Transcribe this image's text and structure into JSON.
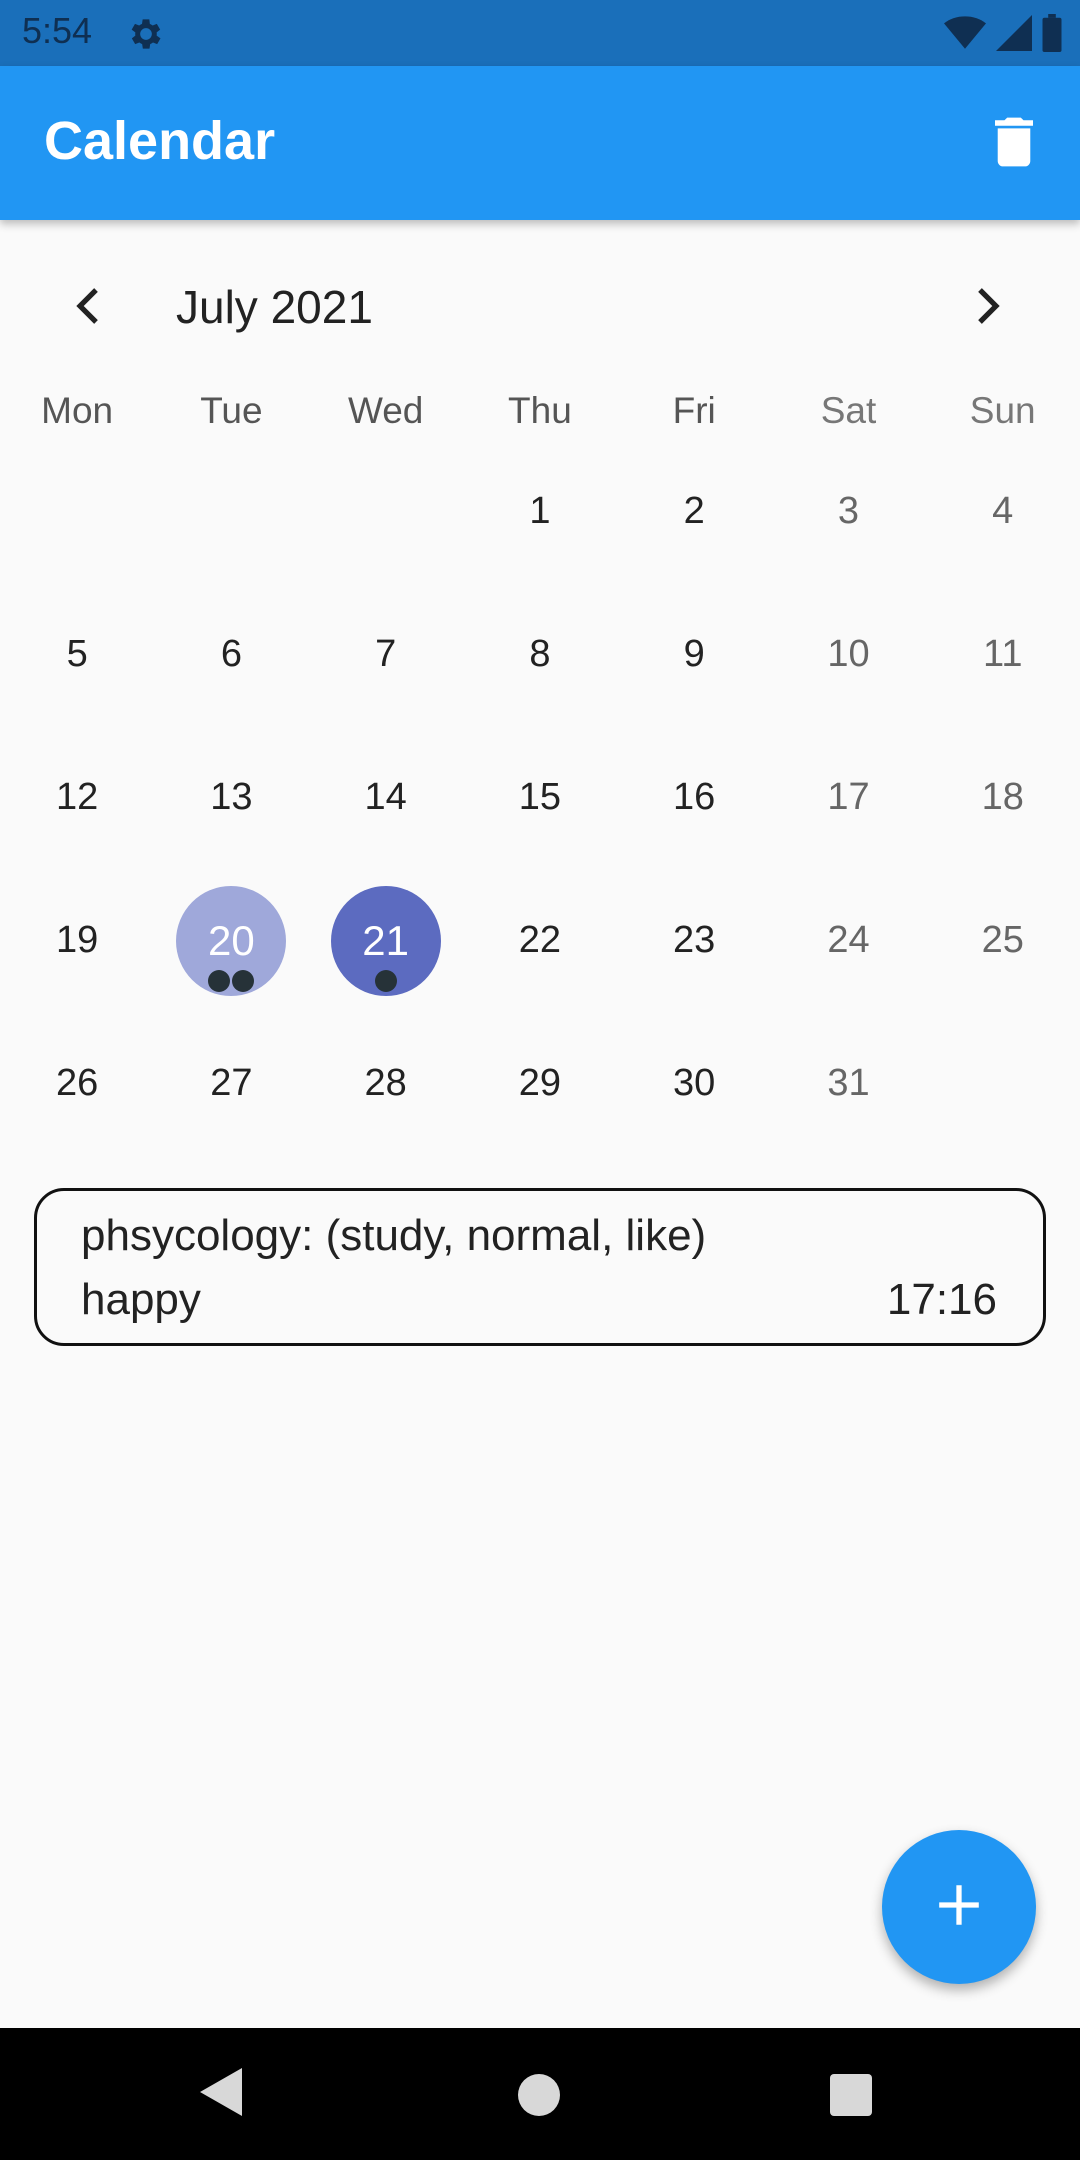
{
  "status_bar": {
    "time": "5:54",
    "icons": [
      "gear-icon",
      "wifi-icon",
      "signal-icon",
      "battery-icon"
    ]
  },
  "app_bar": {
    "title": "Calendar",
    "action_icon": "trash-icon"
  },
  "calendar": {
    "month_label": "July 2021",
    "weekdays": [
      "Mon",
      "Tue",
      "Wed",
      "Thu",
      "Fri",
      "Sat",
      "Sun"
    ],
    "weeks": [
      [
        "",
        "",
        "",
        "1",
        "2",
        "3",
        "4"
      ],
      [
        "5",
        "6",
        "7",
        "8",
        "9",
        "10",
        "11"
      ],
      [
        "12",
        "13",
        "14",
        "15",
        "16",
        "17",
        "18"
      ],
      [
        "19",
        "20",
        "21",
        "22",
        "23",
        "24",
        "25"
      ],
      [
        "26",
        "27",
        "28",
        "29",
        "30",
        "31",
        ""
      ]
    ],
    "highlighted_day": "20",
    "selected_day": "21",
    "event_markers": {
      "20": 2,
      "21": 1
    }
  },
  "event": {
    "title": "phsycology: (study, normal, like)",
    "mood": "happy",
    "time": "17:16"
  },
  "fab": {
    "icon": "plus-icon"
  },
  "colors": {
    "status_bar": "#1a6fba",
    "primary": "#2196f3",
    "highlight_light": "#9fa8da",
    "highlight_dark": "#5c6bc0",
    "marker": "#263238"
  }
}
